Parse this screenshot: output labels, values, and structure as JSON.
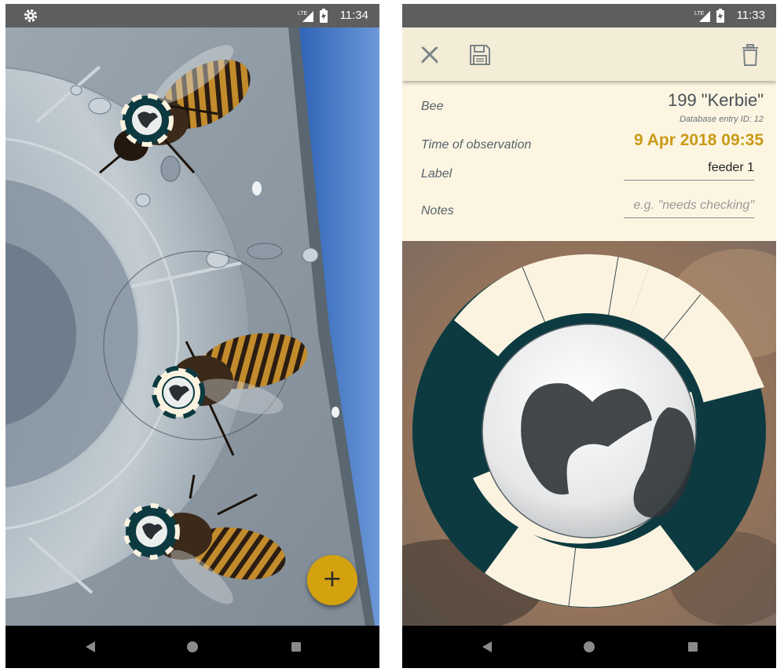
{
  "left_screen": {
    "status_time": "11:34",
    "fab_label": "+",
    "icons": {
      "settings": "gear-icon",
      "add": "plus-icon"
    },
    "colors": {
      "fab": "#d4a20e",
      "marker_dark": "#0c3a40",
      "marker_light": "#fbf3e0"
    }
  },
  "right_screen": {
    "status_time": "11:33",
    "toolbar": {
      "close": "close-icon",
      "save": "save-icon",
      "delete": "trash-icon"
    },
    "bee_label": "Bee",
    "bee_value": "199 \"Kerbie\"",
    "db_entry": "Database entry ID: 12",
    "time_label": "Time of observation",
    "time_value": "9 Apr 2018  09:35",
    "label_label": "Label",
    "label_value": "feeder 1",
    "notes_label": "Notes",
    "notes_placeholder": "e.g. \"needs checking\"",
    "colors": {
      "accent": "#c99a16",
      "toolbar": "#f3ecd7",
      "form": "#fcf5e2",
      "ring_dark": "#0c3a40",
      "ring_light": "#fbf3e0"
    }
  },
  "navigation": {
    "back": "back-icon",
    "home": "home-icon",
    "recents": "recents-icon"
  }
}
